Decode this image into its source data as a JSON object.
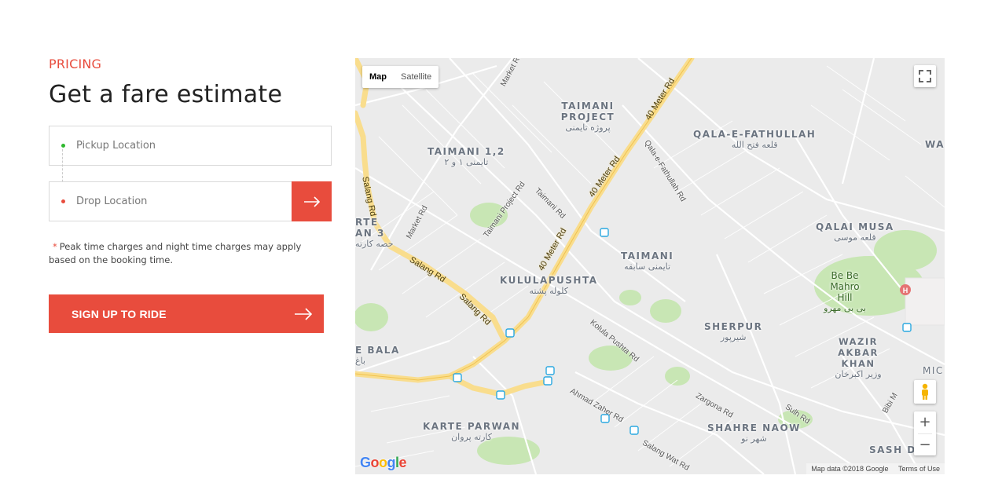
{
  "pricing": {
    "eyebrow": "PRICING",
    "title": "Get a fare estimate",
    "pickup_placeholder": "Pickup Location",
    "drop_placeholder": "Drop Location",
    "note_star": "*",
    "note": "Peak time charges and night time charges may apply based on the booking time.",
    "cta_label": "SIGN UP TO RIDE"
  },
  "colors": {
    "accent": "#e84c3d",
    "pickup_dot": "#2eb82e",
    "drop_dot": "#e84c3d"
  },
  "map": {
    "type_buttons": {
      "map": "Map",
      "satellite": "Satellite"
    },
    "areas": {
      "taimani_project": "TAIMANI PROJECT",
      "taimani_project_local": "پروژه تایمنی",
      "taimani_12": "TAIMANI 1,2",
      "taimani_12_local": "تایمنی ۱ و ۲",
      "qala_e_fathullah": "QALA-E-FATHULLAH",
      "qala_e_fathullah_local": "قلعه فتح الله",
      "qalai_musa": "QALAI MUSA",
      "qalai_musa_local": "قلعه موسی",
      "taimani": "TAIMANI",
      "taimani_local": "تایمنی سابقه",
      "kululapushta": "KULULAPUSHTA",
      "kululapushta_local": "کلوله پشته",
      "sherpur": "SHERPUR",
      "sherpur_local": "شیرپور",
      "wazir": "WAZIR AKBAR KHAN",
      "wazir_local": "وزیر اکبرخان",
      "be_be_mahro": "Be Be Mahro Hill",
      "be_be_mahro_local": "بی بی مهرو",
      "karte_parwan": "KARTE PARWAN",
      "karte_parwan_local": "کارته پروان",
      "shahre_naow": "SHAHRE NAOW",
      "shahre_naow_local": "شهر نو",
      "karte_3": "RTE AN 3",
      "karte_3_local": "حصه کارته",
      "bala": "E BALA",
      "bala_local": "باغ",
      "wa": "WA",
      "mic": "MIC",
      "sash": "SASH D"
    },
    "roads": {
      "salang_1": "Salang Rd",
      "salang_2": "Salang Rd",
      "salang_3": "Salang Rd",
      "meter_1": "40 Meter Rd",
      "meter_2": "40 Meter Rd",
      "meter_3": "40 Meter Rd",
      "market_1": "Market Rd",
      "market_2": "Market Rd",
      "taimani_project_rd": "Taimani Project Rd",
      "taimani_rd": "Taimani Rd",
      "fathullah_rd": "Qala-e-Fathullah Rd",
      "kolula_rd": "Kolula Pushta Rd",
      "ahmad_zaher_rd": "Ahmad Zaher Rd",
      "zargona_rd": "Zargona Rd",
      "sulh_rd": "Sulh Rd",
      "bibi_rd": "Bibi M",
      "salang_wat_rd": "Salang Wat Rd"
    },
    "google": "Google",
    "map_data": "Map data ©2018 Google",
    "terms": "Terms of Use",
    "zoom_in": "+",
    "zoom_out": "−"
  }
}
